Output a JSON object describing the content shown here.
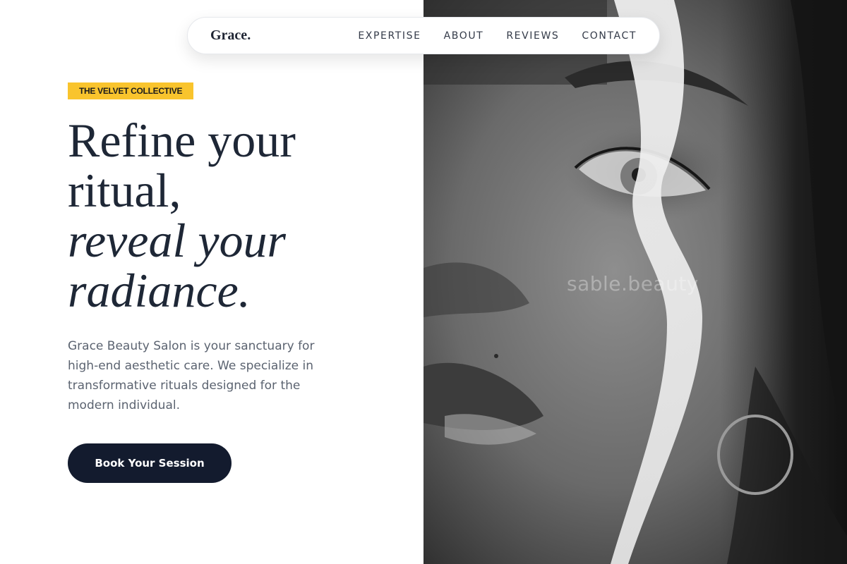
{
  "nav": {
    "brand": "Grace.",
    "links": [
      "EXPERTISE",
      "ABOUT",
      "REVIEWS",
      "CONTACT"
    ]
  },
  "hero": {
    "badge": "THE VELVET COLLECTIVE",
    "headline": {
      "line1": "Refine your",
      "line2": "ritual,",
      "line3": "reveal your",
      "line4": "radiance."
    },
    "description": "Grace Beauty Salon is your sanctuary for high-end aesthetic care. We specialize in transformative rituals designed for the modern individual.",
    "cta_label": "Book Your Session",
    "image_watermark": "sable.beauty"
  },
  "colors": {
    "accent_badge": "#f9c42d",
    "primary_dark": "#131b2e",
    "heading": "#1e2736",
    "body_text": "#5b6370"
  }
}
